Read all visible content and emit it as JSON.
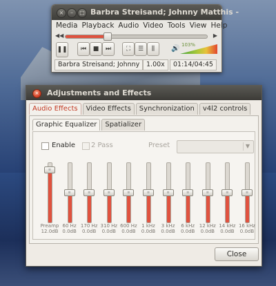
{
  "vlc": {
    "title": "Barbra Streisand; Johnny Matthis -",
    "window_controls": [
      "×",
      "–",
      "□"
    ],
    "menu": [
      "Media",
      "Playback",
      "Audio",
      "Video",
      "Tools",
      "View",
      "Help"
    ],
    "seek": {
      "left_glyph": "◀◀",
      "right_glyph": "▶",
      "progress": 0.28
    },
    "controls": {
      "pause_glyph": "❚❚",
      "prev_glyph": "⏮",
      "stop_glyph": "■",
      "next_glyph": "⏭",
      "fullscreen_glyph": "⛶",
      "playlist_glyph": "☰",
      "ext_glyph": "⫼"
    },
    "volume": {
      "icon": "speaker-icon",
      "glyph": "🔊",
      "percent_label": "103%",
      "level": 1.03
    },
    "status": {
      "now_playing": "Barbra Streisand; Johnny M",
      "rate": "1.00x",
      "time": "01:14/04:45"
    }
  },
  "dialog": {
    "title": "Adjustments and Effects",
    "close_glyph": "×",
    "tabs": [
      "Audio Effects",
      "Video Effects",
      "Synchronization",
      "v4l2 controls"
    ],
    "active_tab": 0,
    "subtabs": [
      "Graphic Equalizer",
      "Spatializer"
    ],
    "active_subtab": 0,
    "enable_label": "Enable",
    "two_pass_label": "2 Pass",
    "preset_label": "Preset",
    "preset_value": "",
    "preset_arrow": "▼",
    "bands": [
      {
        "name": "Preamp",
        "value": "12.0dB",
        "level": 0.88
      },
      {
        "name": "60 Hz",
        "value": "0.0dB",
        "level": 0.5
      },
      {
        "name": "170 Hz",
        "value": "0.0dB",
        "level": 0.5
      },
      {
        "name": "310 Hz",
        "value": "0.0dB",
        "level": 0.5
      },
      {
        "name": "600 Hz",
        "value": "0.0dB",
        "level": 0.5
      },
      {
        "name": "1 kHz",
        "value": "0.0dB",
        "level": 0.5
      },
      {
        "name": "3 kHz",
        "value": "0.0dB",
        "level": 0.5
      },
      {
        "name": "6 kHz",
        "value": "0.0dB",
        "level": 0.5
      },
      {
        "name": "12 kHz",
        "value": "0.0dB",
        "level": 0.5
      },
      {
        "name": "14 kHz",
        "value": "0.0dB",
        "level": 0.5
      },
      {
        "name": "16 kHz",
        "value": "0.0dB",
        "level": 0.5
      }
    ],
    "close_button": "Close"
  },
  "colors": {
    "accent": "#e0523f",
    "titlebar": "#3e3d39"
  }
}
